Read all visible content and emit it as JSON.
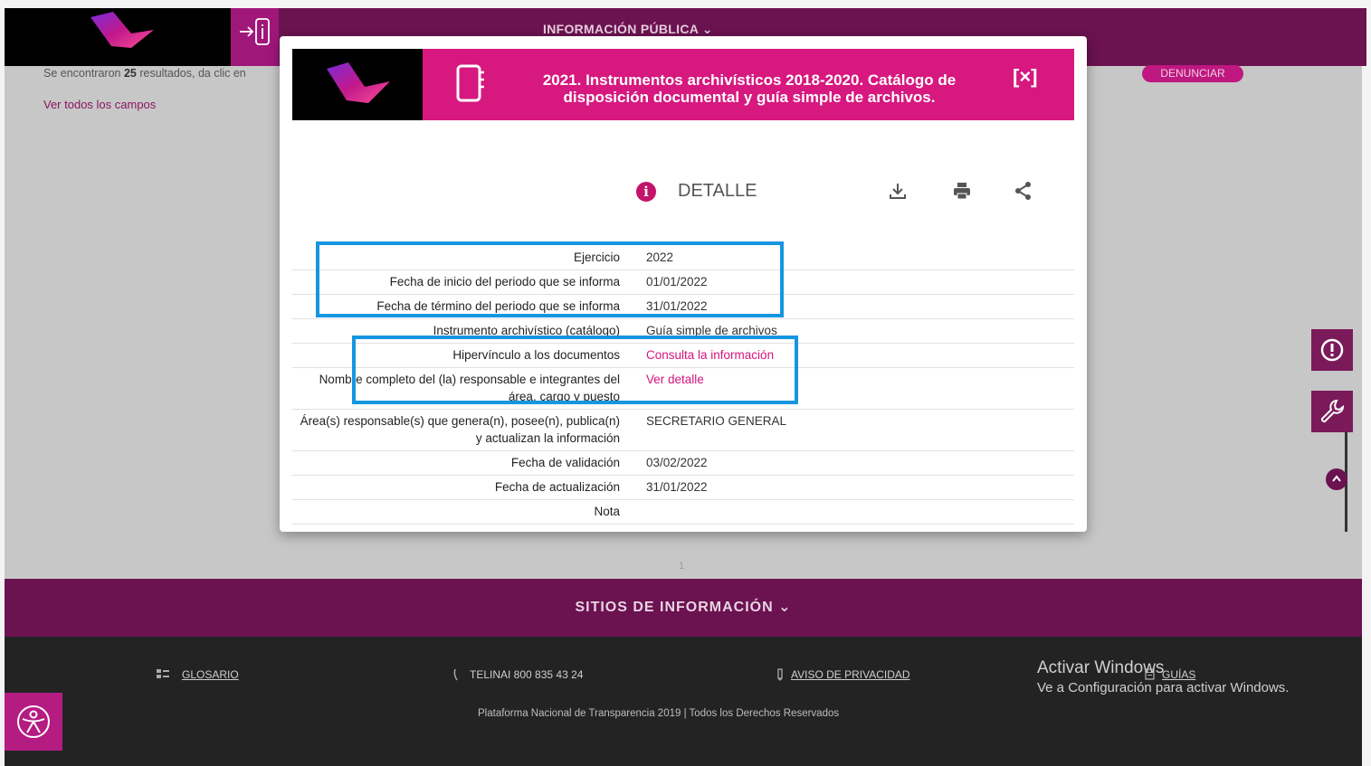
{
  "top": {
    "menu_label": "INFORMACIÓN PÚBLICA ⌄"
  },
  "background": {
    "results_prefix": "Se encontraron ",
    "results_count": "25",
    "results_suffix": " resultados, da clic en",
    "view_all_fields": "Ver todos los campos",
    "report_button": "DENUNCIAR",
    "page_number": "1"
  },
  "modal": {
    "title": "2021. Instrumentos archivísticos 2018-2020. Catálogo de disposición documental y guía simple de archivos.",
    "close_label": "[×]",
    "detail_label": "DETALLE",
    "rows": [
      {
        "label": "Ejercicio",
        "value": "2022",
        "link": false
      },
      {
        "label": "Fecha de inicio del periodo que se informa",
        "value": "01/01/2022",
        "link": false
      },
      {
        "label": "Fecha de término del periodo que se informa",
        "value": "31/01/2022",
        "link": false
      },
      {
        "label": "Instrumento archivístico (catálogo)",
        "value": "Guía simple de archivos",
        "link": false
      },
      {
        "label": "Hipervínculo a los documentos",
        "value": "Consulta la información",
        "link": true
      },
      {
        "label": "Nombre completo del (la) responsable e integrantes del área, cargo y puesto",
        "value": "Ver detalle",
        "link": true
      },
      {
        "label": "Área(s) responsable(s) que genera(n), posee(n), publica(n) y actualizan la información",
        "value": "SECRETARIO GENERAL",
        "link": false
      },
      {
        "label": "Fecha de validación",
        "value": "03/02/2022",
        "link": false
      },
      {
        "label": "Fecha de actualización",
        "value": "31/01/2022",
        "link": false
      },
      {
        "label": "Nota",
        "value": "",
        "link": false
      }
    ]
  },
  "footer": {
    "sites_label": "SITIOS DE INFORMACIÓN ⌄",
    "glossary": "GLOSARIO",
    "telinai": "TELINAI 800 835 43 24",
    "privacy": "AVISO DE PRIVACIDAD",
    "guides": "GUÍAS",
    "copyright": "Plataforma Nacional de Transparencia 2019 | Todos los Derechos Reservados"
  },
  "windows_watermark": {
    "line1": "Activar Windows",
    "line2": "Ve a Configuración para activar Windows."
  },
  "colors": {
    "brand": "#6b1250",
    "accent": "#d6187f",
    "highlight": "#1596e0"
  }
}
